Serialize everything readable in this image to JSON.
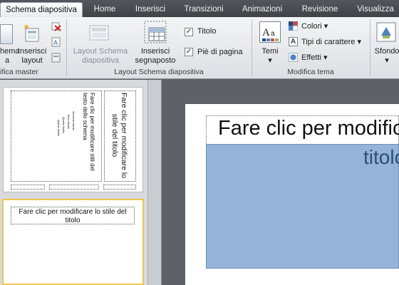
{
  "tabs": [
    "Schema diapositiva",
    "Home",
    "Inserisci",
    "Transizioni",
    "Animazioni",
    "Revisione",
    "Visualizza"
  ],
  "ribbon": {
    "master_group": {
      "label": "ifica master",
      "schema_btn": [
        "hema",
        "a"
      ],
      "insert_layout": [
        "Inserisci",
        "layout"
      ]
    },
    "layout_group": {
      "label": "Layout Schema diapositiva",
      "layout_schema": [
        "Layout Schema",
        "diapositiva"
      ],
      "insert_placeholder": [
        "Inserisci",
        "segnaposto"
      ],
      "title_check": "Titolo",
      "footer_check": "Piè di pagina"
    },
    "theme_group": {
      "label": "Modifica tema",
      "themes": "Temi",
      "colors": "Colori",
      "fonts": "Tipi di carattere",
      "effects": "Effetti"
    },
    "background": {
      "label": "Sfondo"
    }
  },
  "thumbnail1": {
    "title_vertical": "Fare clic per modificare lo stile del titolo",
    "text_vertical": "Fare clic per modificare stili del testo dello schema",
    "levels": [
      "Secondo livello",
      "Terzo livello",
      "Quarto livello",
      "Quinto livello"
    ]
  },
  "thumbnail2": {
    "title": "Fare clic per modificare lo stile del titolo"
  },
  "slide": {
    "title": "Fare clic per modificare",
    "subtitle": "titolo"
  },
  "colors": {
    "accent_blue": "#95b3d7",
    "selection_gold": "#f0c64b"
  }
}
